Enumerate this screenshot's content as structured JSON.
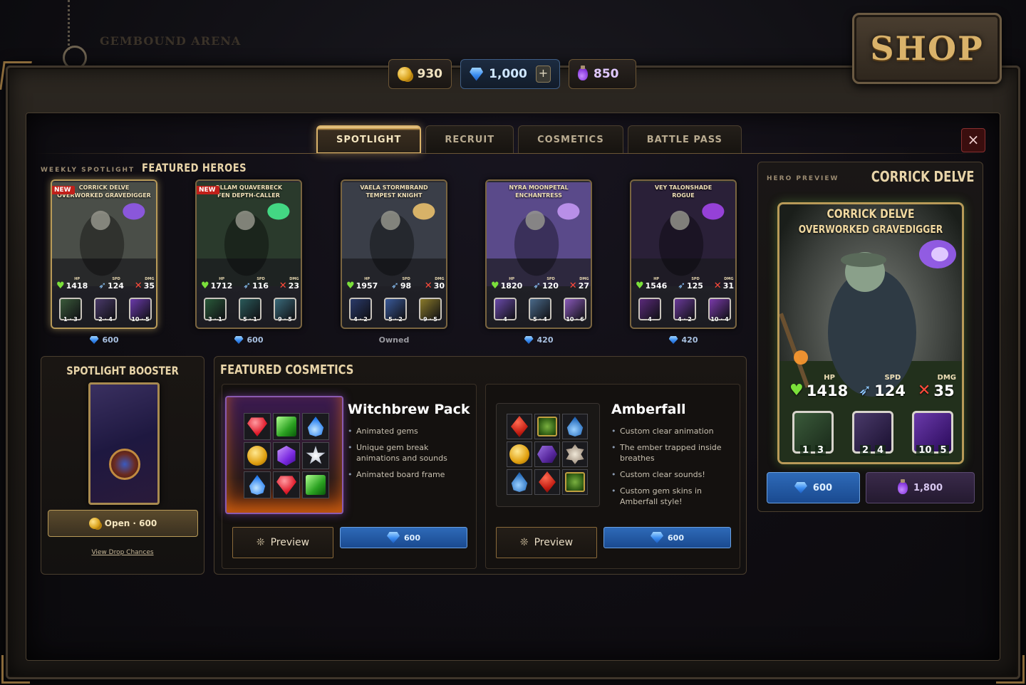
{
  "background": {
    "logo_text": "GEMBOUND ARENA"
  },
  "shop_title": "SHOP",
  "currencies": {
    "gold": {
      "icon": "gold-coins-icon",
      "value": "930"
    },
    "gems": {
      "icon": "gem-icon",
      "value": "1,000",
      "plus": "+"
    },
    "elixir": {
      "icon": "elixir-icon",
      "value": "850"
    }
  },
  "tabs": [
    {
      "label": "SPOTLIGHT",
      "active": true
    },
    {
      "label": "RECRUIT",
      "active": false
    },
    {
      "label": "COSMETICS",
      "active": false
    },
    {
      "label": "BATTLE PASS",
      "active": false
    }
  ],
  "close_label": "×",
  "featured": {
    "kicker": "WEEKLY SPOTLIGHT",
    "title": "FEATURED HEROES"
  },
  "heroes": [
    {
      "name": "CORRICK DELVE",
      "title": "OVERWORKED GRAVEDIGGER",
      "badge": "NEW",
      "hp": "1418",
      "spd": "124",
      "dmg": "35",
      "skills": [
        {
          "a": "1",
          "b": "3"
        },
        {
          "a": "2",
          "b": "4"
        },
        {
          "a": "10",
          "b": "5"
        }
      ],
      "price": "600",
      "currency": "gem",
      "art_color": "#4a4e48",
      "accent": "#9a5aff"
    },
    {
      "name": "OLLAM QUAVERBECK",
      "title": "FEN DEPTH-CALLER",
      "badge": "NEW",
      "hp": "1712",
      "spd": "116",
      "dmg": "23",
      "skills": [
        {
          "a": "3",
          "b": "1"
        },
        {
          "a": "5",
          "b": "1"
        },
        {
          "a": "9",
          "b": "5"
        }
      ],
      "price": "600",
      "currency": "gem",
      "art_color": "#2a3a2c",
      "accent": "#4aff9a"
    },
    {
      "name": "VAELA STORMBRAND",
      "title": "TEMPEST KNIGHT",
      "badge": "",
      "hp": "1957",
      "spd": "98",
      "dmg": "30",
      "skills": [
        {
          "a": "4",
          "b": "2"
        },
        {
          "a": "5",
          "b": "2"
        },
        {
          "a": "9",
          "b": "5"
        }
      ],
      "price": "Owned",
      "currency": "",
      "art_color": "#3a3e48",
      "accent": "#ffd070"
    },
    {
      "name": "NYRA MOONPETAL",
      "title": "ENCHANTRESS",
      "badge": "",
      "hp": "1820",
      "spd": "120",
      "dmg": "27",
      "skills": [
        {
          "a": "4",
          "b": ""
        },
        {
          "a": "5",
          "b": "4"
        },
        {
          "a": "10",
          "b": "6"
        }
      ],
      "price": "420",
      "currency": "gem",
      "art_color": "#5a4a8a",
      "accent": "#d0a0ff"
    },
    {
      "name": "VEY TALONSHADE",
      "title": "ROGUE",
      "badge": "",
      "hp": "1546",
      "spd": "125",
      "dmg": "31",
      "skills": [
        {
          "a": "4",
          "b": ""
        },
        {
          "a": "4",
          "b": "2"
        },
        {
          "a": "10",
          "b": "4"
        }
      ],
      "price": "420",
      "currency": "gem",
      "art_color": "#2a2038",
      "accent": "#b04aff"
    }
  ],
  "stat_labels": {
    "hp": "HP",
    "spd": "SPD",
    "dmg": "DMG"
  },
  "booster": {
    "title": "SPOTLIGHT BOOSTER",
    "button": "Open · 600",
    "link": "View Drop Chances"
  },
  "cosmetics": {
    "title": "FEATURED COSMETICS",
    "items": [
      {
        "name": "Witchbrew Pack",
        "features": [
          "Animated gems",
          "Unique gem break animations and sounds",
          "Animated board frame"
        ],
        "preview": "Preview",
        "price": "600",
        "board": [
          "red",
          "green",
          "blue",
          "gold",
          "purple",
          "white",
          "blue",
          "red",
          "green"
        ]
      },
      {
        "name": "Amberfall",
        "features": [
          "Custom clear animation",
          "The ember trapped inside breathes",
          "Custom clear sounds!",
          "Custom gem skins in Amberfall style!"
        ],
        "preview": "Preview",
        "price": "600",
        "board": [
          "red",
          "green",
          "blue",
          "gold",
          "purple",
          "white",
          "blue",
          "red",
          "green"
        ]
      }
    ]
  },
  "hero_preview": {
    "kicker": "HERO PREVIEW",
    "name": "CORRICK DELVE",
    "card_name": "CORRICK DELVE",
    "card_title": "OVERWORKED GRAVEDIGGER",
    "hp": "1418",
    "spd": "124",
    "dmg": "35",
    "skills": [
      {
        "a": "1",
        "b": "3"
      },
      {
        "a": "2",
        "b": "4"
      },
      {
        "a": "10",
        "b": "5"
      }
    ],
    "price_gem": "600",
    "price_elixir": "1,800"
  },
  "colors": {
    "gold_accent": "#d9b26a",
    "gem_blue": "#2e6ab8",
    "new_red": "#c0201a"
  }
}
